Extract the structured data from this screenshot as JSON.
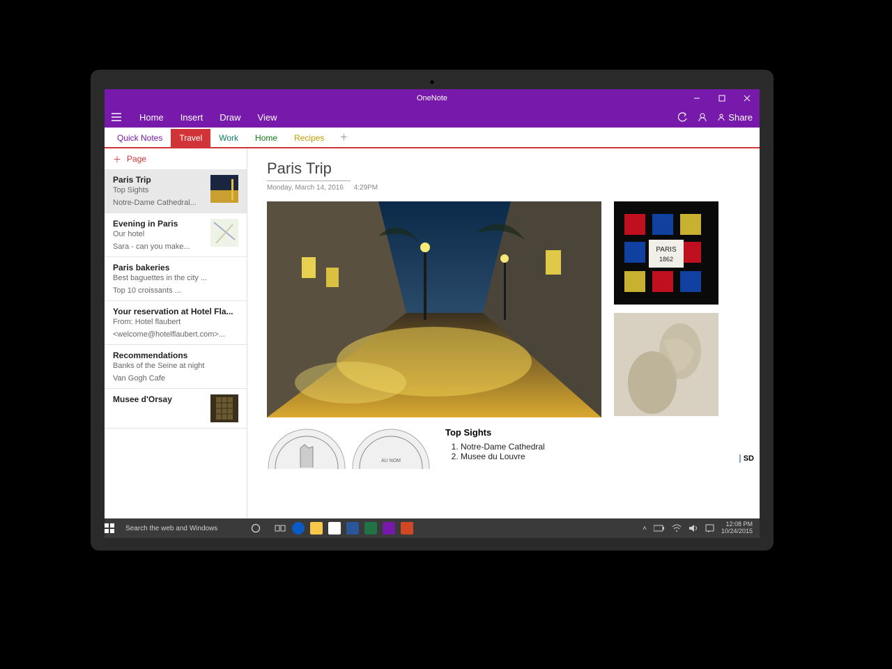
{
  "app_title": "OneNote",
  "ribbon": {
    "menu": [
      "Home",
      "Insert",
      "Draw",
      "View"
    ],
    "share": "Share"
  },
  "sections": [
    {
      "label": "Quick Notes"
    },
    {
      "label": "Travel"
    },
    {
      "label": "Work"
    },
    {
      "label": "Home"
    },
    {
      "label": "Recipes"
    }
  ],
  "addpage_label": "Page",
  "pages": [
    {
      "title": "Paris Trip",
      "sub": "Top Sights",
      "sub2": "Notre-Dame Cathedral...",
      "thumb": "street"
    },
    {
      "title": "Evening in Paris",
      "sub": "Our hotel",
      "sub2": "Sara - can you make...",
      "thumb": "map"
    },
    {
      "title": "Paris bakeries",
      "sub": "Best baguettes in the city ...",
      "sub2": "Top 10 croissants ...",
      "thumb": ""
    },
    {
      "title": "Your reservation at Hotel Fla...",
      "sub": "From: Hotel flaubert",
      "sub2": "<welcome@hotelflaubert.com>...",
      "thumb": ""
    },
    {
      "title": "Recommendations",
      "sub": "Banks of the Seine at night",
      "sub2": "Van Gogh Cafe",
      "thumb": ""
    },
    {
      "title": "Musee d'Orsay",
      "sub": "",
      "sub2": "",
      "thumb": "window"
    }
  ],
  "note": {
    "title": "Paris Trip",
    "date": "Monday, March 14, 2016",
    "time": "4:29PM",
    "stainedglass_caption": "PARIS",
    "stainedglass_year": "1862",
    "top_sights_heading": "Top Sights",
    "top_sights": [
      "Notre-Dame Cathedral",
      "Musee du Louvre"
    ],
    "badge": "SD"
  },
  "taskbar": {
    "search_placeholder": "Search the web and Windows",
    "time": "12:08 PM",
    "date": "10/24/2015"
  }
}
